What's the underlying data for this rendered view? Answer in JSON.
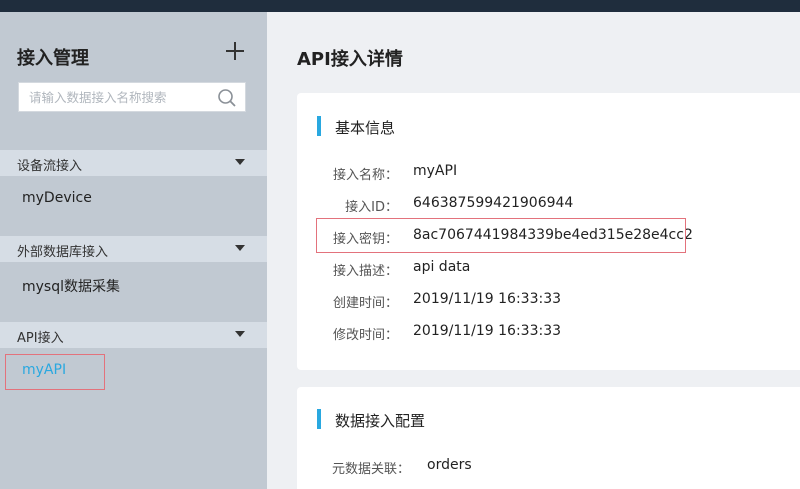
{
  "sidebar": {
    "title": "接入管理",
    "search_placeholder": "请输入数据接入名称搜索",
    "groups": [
      {
        "label": "设备流接入",
        "items": [
          "myDevice"
        ]
      },
      {
        "label": "外部数据库接入",
        "items": [
          "mysql数据采集"
        ]
      },
      {
        "label": "API接入",
        "items": [
          "myAPI"
        ]
      }
    ]
  },
  "main": {
    "title": "API接入详情",
    "basic": {
      "title": "基本信息",
      "rows": [
        {
          "label": "接入名称：",
          "value": "myAPI"
        },
        {
          "label": "接入ID：",
          "value": "646387599421906944"
        },
        {
          "label": "接入密钥：",
          "value": "8ac7067441984339be4ed315e28e4cc2"
        },
        {
          "label": "接入描述：",
          "value": "api data"
        },
        {
          "label": "创建时间：",
          "value": "2019/11/19 16:33:33"
        },
        {
          "label": "修改时间：",
          "value": "2019/11/19 16:33:33"
        }
      ]
    },
    "config": {
      "title": "数据接入配置",
      "rows": [
        {
          "label": "元数据关联：",
          "value": "orders"
        }
      ]
    }
  },
  "colors": {
    "accent": "#29a8e0",
    "highlight": "#e3727c",
    "sidebar": "#c1c9d2",
    "topbar": "#1f2d3d"
  }
}
